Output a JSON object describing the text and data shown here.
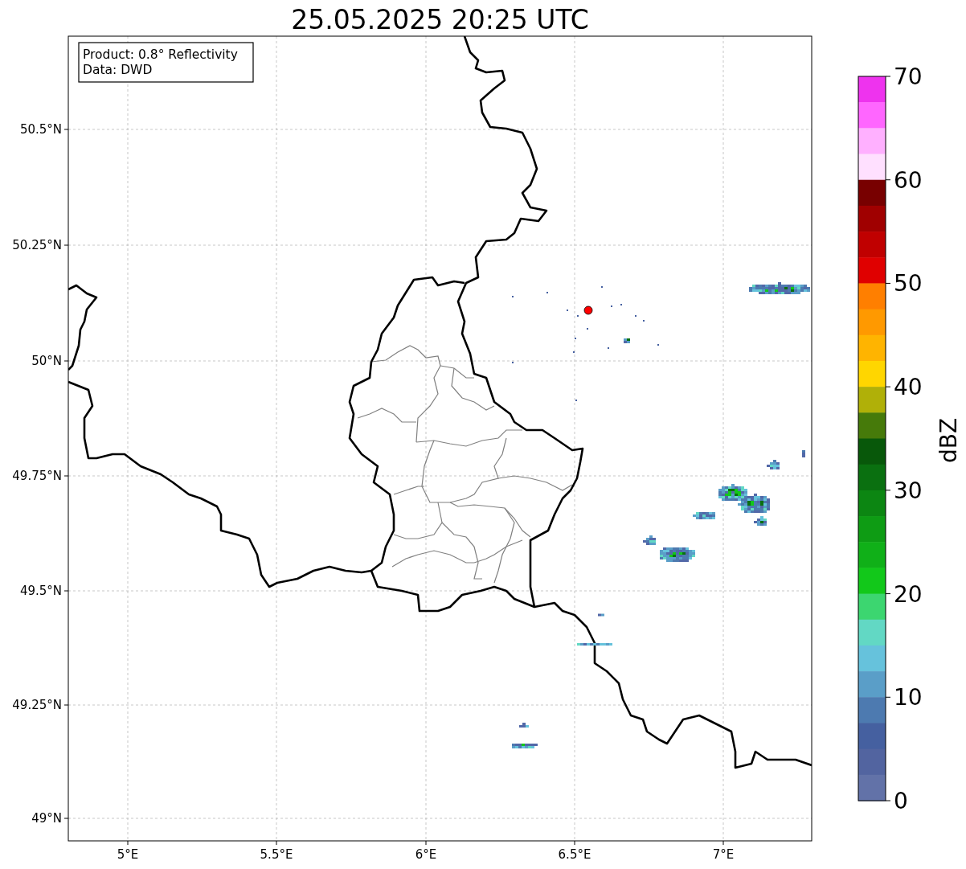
{
  "title": "25.05.2025 20:25 UTC",
  "info_box": {
    "lines": [
      "Product: 0.8° Reflectivity",
      "Data: DWD"
    ]
  },
  "map": {
    "y_ticks": [
      "50.5°N",
      "50.25°N",
      "50°N",
      "49.75°N",
      "49.5°N",
      "49.25°N",
      "49°N"
    ],
    "x_ticks": [
      "5°E",
      "5.5°E",
      "6°E",
      "6.5°E",
      "7°E"
    ]
  },
  "colorbar": {
    "label": "dBZ",
    "ticks": [
      "70",
      "60",
      "50",
      "40",
      "30",
      "20",
      "10",
      "0"
    ],
    "segments": [
      {
        "color": "#ee33ee"
      },
      {
        "color": "#ff66ff"
      },
      {
        "color": "#ffb0ff"
      },
      {
        "color": "#ffe0ff"
      },
      {
        "color": "#780000"
      },
      {
        "color": "#a00000"
      },
      {
        "color": "#c00000"
      },
      {
        "color": "#e00000"
      },
      {
        "color": "#ff7f00"
      },
      {
        "color": "#ff9900"
      },
      {
        "color": "#ffb400"
      },
      {
        "color": "#ffd600"
      },
      {
        "color": "#b0b008"
      },
      {
        "color": "#467a0a"
      },
      {
        "color": "#08580a"
      },
      {
        "color": "#0a7010"
      },
      {
        "color": "#0c8612"
      },
      {
        "color": "#0e9c14"
      },
      {
        "color": "#10b018"
      },
      {
        "color": "#12c81a"
      },
      {
        "color": "#3cd670"
      },
      {
        "color": "#62d8c4"
      },
      {
        "color": "#66c2dc"
      },
      {
        "color": "#5a9ec8"
      },
      {
        "color": "#4d7ab0"
      },
      {
        "color": "#4560a0"
      },
      {
        "color": "#5264a0"
      },
      {
        "color": "#6272a8"
      }
    ]
  }
}
